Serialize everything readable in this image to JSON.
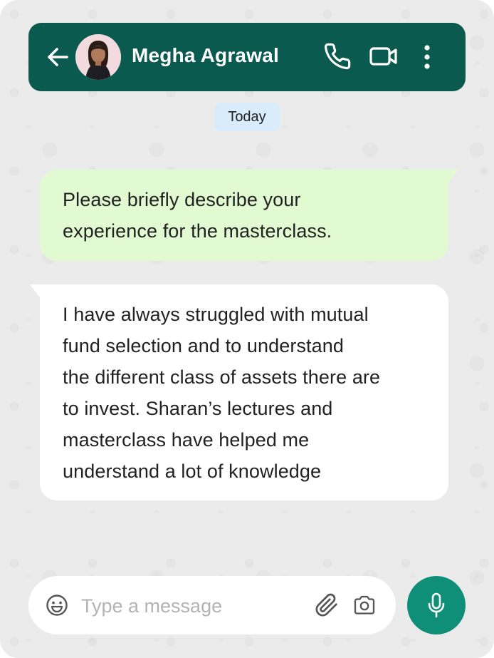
{
  "header": {
    "contact_name": "Megha Agrawal"
  },
  "icons": {
    "back": "arrow-left-icon",
    "avatar": "profile-photo",
    "call": "phone-icon",
    "video": "video-camera-icon",
    "menu": "vertical-ellipsis-icon",
    "emoji": "smiley-icon",
    "attach": "paperclip-icon",
    "camera": "camera-icon",
    "mic": "microphone-icon"
  },
  "chat": {
    "date_label": "Today",
    "messages": [
      {
        "direction": "outgoing",
        "lines": [
          "Please briefly describe your",
          "experience for the masterclass."
        ]
      },
      {
        "direction": "incoming",
        "lines": [
          "I have always struggled with mutual",
          "fund selection and to understand",
          "the different class of assets there are",
          "to invest. Sharan’s lectures and",
          "masterclass have helped me",
          "understand a lot of knowledge"
        ]
      }
    ]
  },
  "composer": {
    "placeholder": "Type a message",
    "value": ""
  },
  "colors": {
    "header_bg": "#0b5a4f",
    "outgoing_bubble": "#e2fad2",
    "incoming_bubble": "#ffffff",
    "date_badge": "#d8ecfb",
    "mic_button": "#0f8e78",
    "chat_bg": "#ebebeb"
  }
}
